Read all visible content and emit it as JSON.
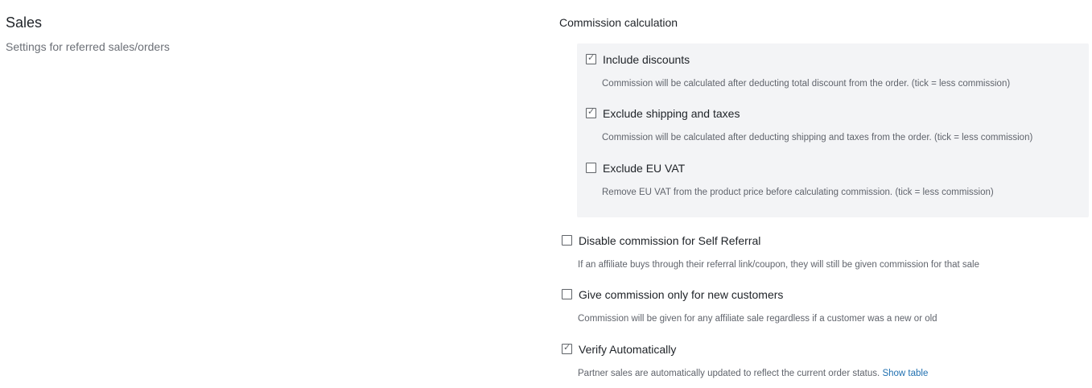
{
  "sales": {
    "title": "Sales",
    "subtitle": "Settings for referred sales/orders"
  },
  "commission": {
    "title": "Commission calculation",
    "options": [
      {
        "label": "Include discounts",
        "checked": true,
        "description": "Commission will be calculated after deducting total discount from the order. (tick = less commission)"
      },
      {
        "label": "Exclude shipping and taxes",
        "checked": true,
        "description": "Commission will be calculated after deducting shipping and taxes from the order. (tick = less commission)"
      },
      {
        "label": "Exclude EU VAT",
        "checked": false,
        "description": "Remove EU VAT from the product price before calculating commission. (tick = less commission)"
      }
    ]
  },
  "settings": [
    {
      "label": "Disable commission for Self Referral",
      "checked": false,
      "description": "If an affiliate buys through their referral link/coupon, they will still be given commission for that sale"
    },
    {
      "label": "Give commission only for new customers",
      "checked": false,
      "description": "Commission will be given for any affiliate sale regardless if a customer was a new or old"
    },
    {
      "label": "Verify Automatically",
      "checked": true,
      "description": "Partner sales are automatically updated to reflect the current order status.",
      "link_label": "Show table"
    }
  ],
  "check_glyph": "✓"
}
